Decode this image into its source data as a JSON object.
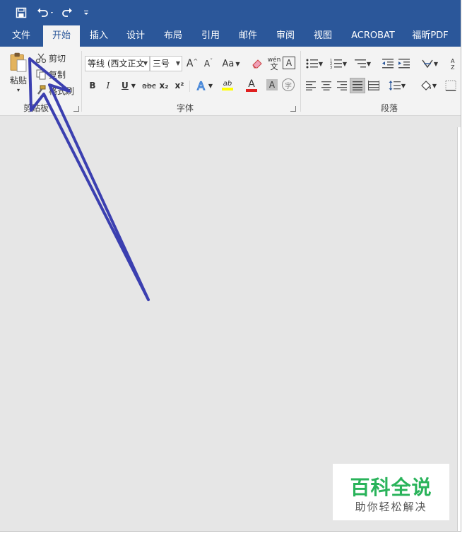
{
  "tabs": {
    "file": "文件",
    "home": "开始",
    "insert": "插入",
    "design": "设计",
    "layout": "布局",
    "references": "引用",
    "mailings": "邮件",
    "review": "审阅",
    "view": "视图",
    "acrobat": "ACROBAT",
    "foxit_pdf": "福昕PDF"
  },
  "clipboard": {
    "paste": "粘贴",
    "cut": "剪切",
    "copy": "复制",
    "format_painter": "格式刷",
    "group_label": "剪贴板"
  },
  "font": {
    "font_name": "等线 (西文正文",
    "font_size": "三号",
    "bold": "B",
    "italic": "I",
    "underline": "U",
    "strikethrough": "abc",
    "subscript": "x₂",
    "superscript": "x²",
    "change_case": "Aa",
    "phonetic_top": "wén",
    "phonetic_bottom": "文",
    "border_char": "A",
    "highlight_label": "ab",
    "font_color_label": "A",
    "shade_label": "A",
    "enclose_char": "字",
    "grow": "A",
    "shrink": "A",
    "group_label": "字体"
  },
  "paragraph": {
    "group_label": "段落"
  },
  "watermark": {
    "title": "百科全说",
    "subtitle": "助你轻松解决"
  },
  "colors": {
    "ribbon_blue": "#2b579a",
    "ribbon_bg": "#f3f3f3",
    "doc_bg": "#e6e6e6",
    "arrow": "#3b3fb0",
    "watermark_green": "#29b35a",
    "font_color_red": "#e02020",
    "highlight_yellow": "#ffff00"
  }
}
